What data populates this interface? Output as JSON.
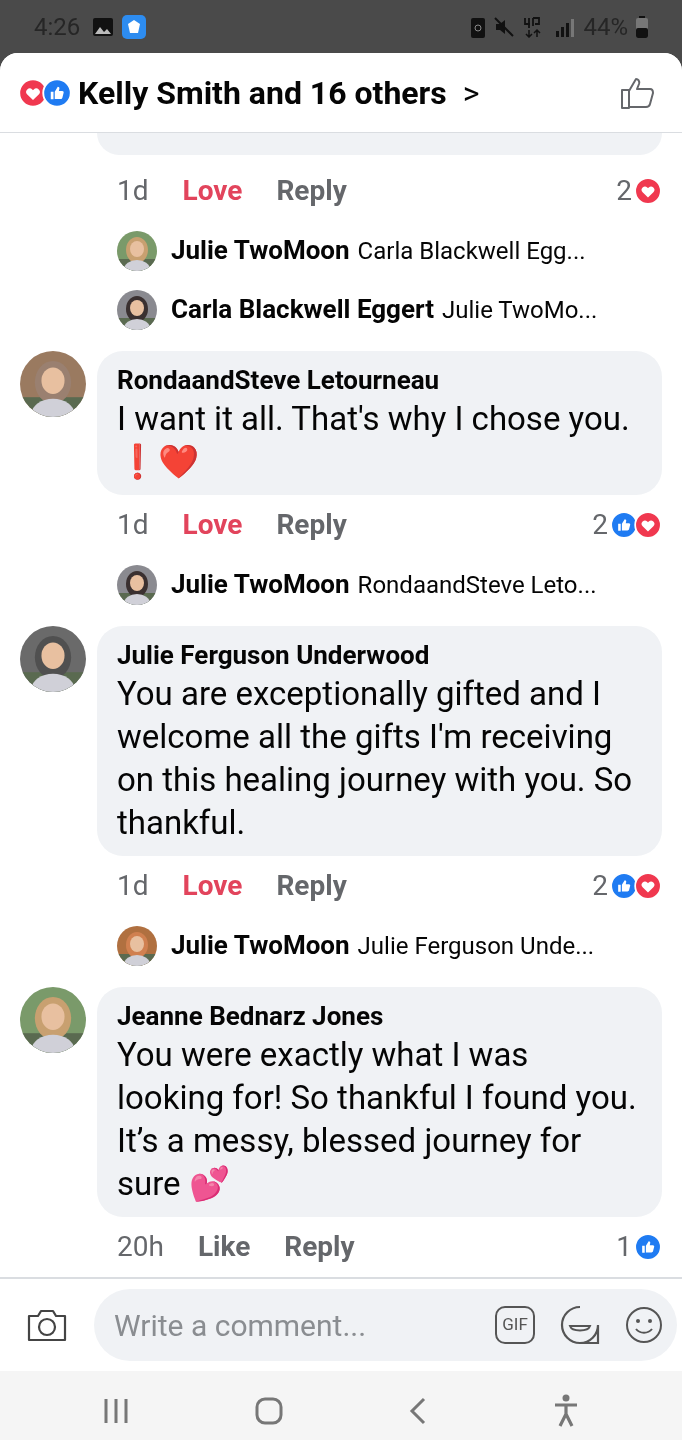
{
  "status_bar": {
    "time": "4:26",
    "battery": "44%"
  },
  "header": {
    "title": "Kelly Smith and 16 others",
    "reactions": [
      {
        "kind": "love"
      },
      {
        "kind": "like"
      }
    ],
    "chevron": ">"
  },
  "thread": [
    {
      "kind": "tail",
      "time": "1d",
      "react_label": "Love",
      "reacted": true,
      "reply": "Reply",
      "count": "2",
      "reactions": [
        {
          "kind": "love"
        }
      ],
      "replies": [
        {
          "name": "Julie TwoMoon",
          "text": "Carla Blackwell Egg..."
        },
        {
          "name": "Carla Blackwell Eggert",
          "text": "Julie TwoMo..."
        }
      ]
    },
    {
      "kind": "comment",
      "name": "RondaandSteve Letourneau",
      "text": "I want it all. That's why I chose you. ❗❤️",
      "time": "1d",
      "react_label": "Love",
      "reacted": true,
      "reply": "Reply",
      "count": "2",
      "reactions": [
        {
          "kind": "like"
        },
        {
          "kind": "love"
        }
      ],
      "replies": [
        {
          "name": "Julie TwoMoon",
          "text": "RondaandSteve Leto..."
        }
      ]
    },
    {
      "kind": "comment",
      "name": "Julie Ferguson Underwood",
      "text": "You are exceptionally gifted and I welcome all the gifts I'm receiving on this healing journey with you. So thankful.",
      "time": "1d",
      "react_label": "Love",
      "reacted": true,
      "reply": "Reply",
      "count": "2",
      "reactions": [
        {
          "kind": "like"
        },
        {
          "kind": "love"
        }
      ],
      "replies": [
        {
          "name": "Julie TwoMoon",
          "text": "Julie Ferguson Unde..."
        }
      ]
    },
    {
      "kind": "comment",
      "name": "Jeanne Bednarz Jones",
      "text": "You were exactly what I was looking for! So thankful I found you. It’s a messy, blessed journey for sure 💕",
      "time": "20h",
      "react_label": "Like",
      "reacted": false,
      "reply": "Reply",
      "count": "1",
      "reactions": [
        {
          "kind": "like"
        }
      ]
    }
  ],
  "composer": {
    "placeholder": "Write a comment...",
    "gif": "GIF"
  }
}
